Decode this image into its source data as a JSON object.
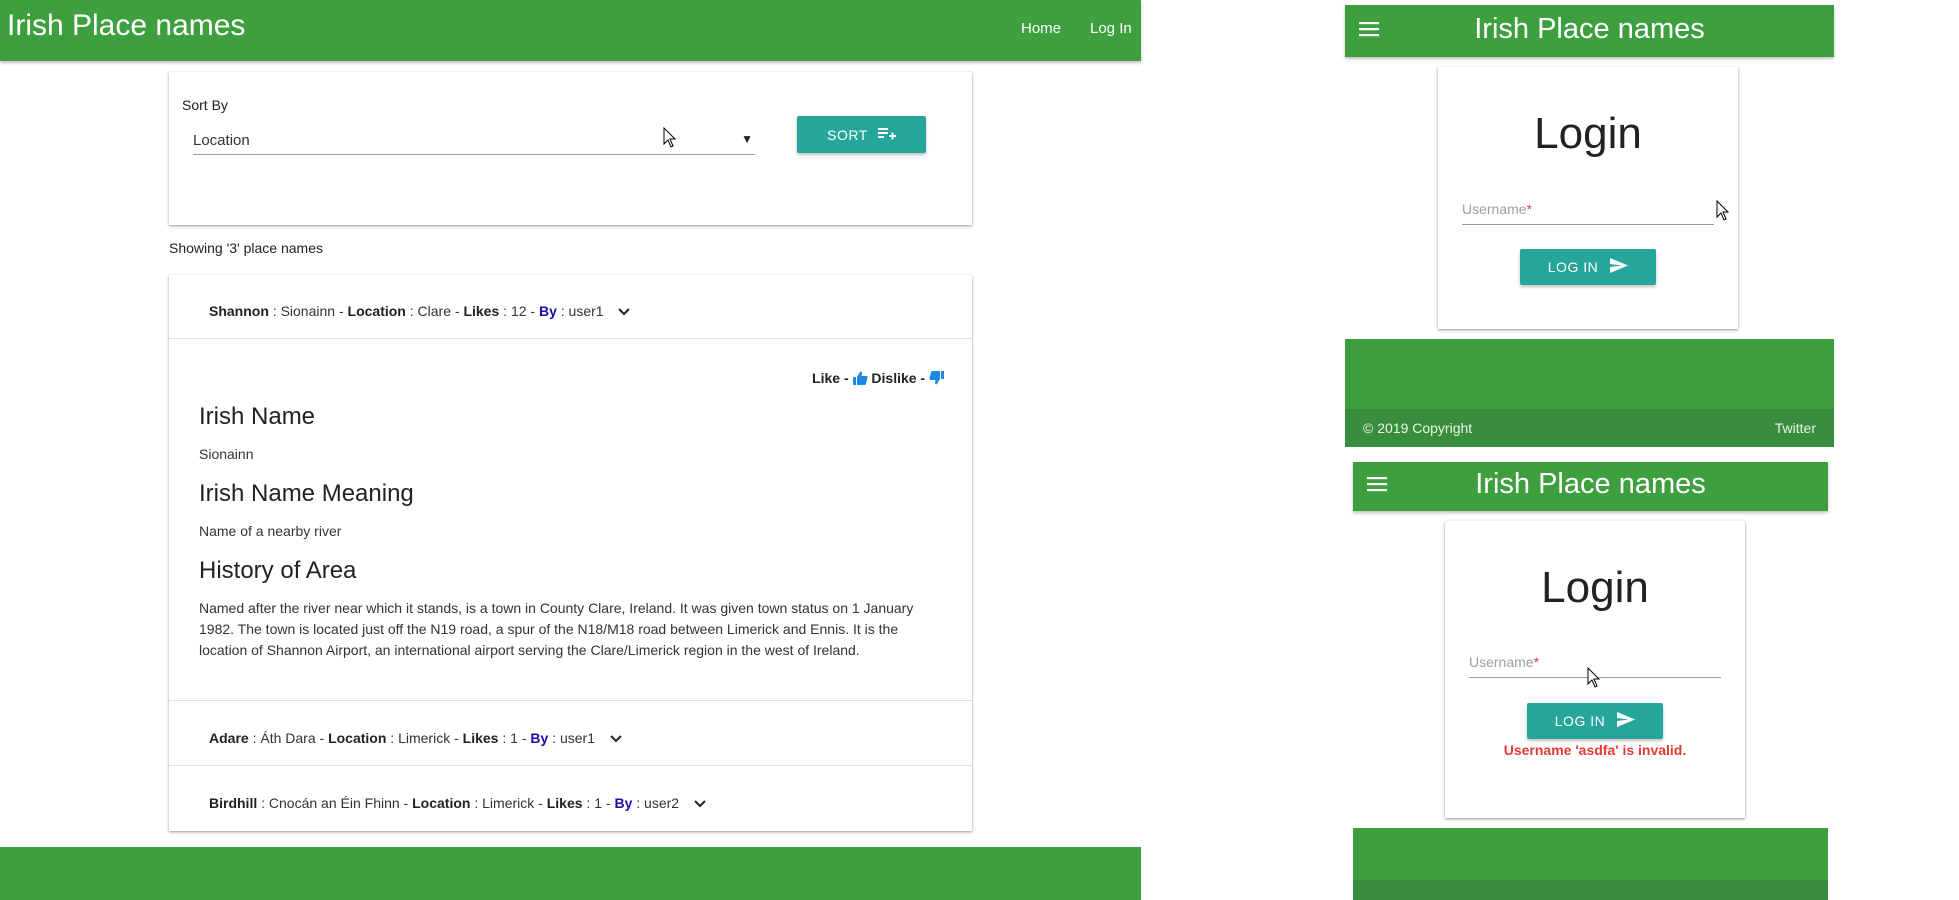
{
  "app_title": "Irish Place names",
  "nav": {
    "home": "Home",
    "login": "Log In"
  },
  "sort": {
    "label": "Sort By",
    "selected": "Location",
    "caret": "▼",
    "button": "SORT"
  },
  "showing_text": "Showing '3' place names",
  "places": [
    {
      "name": "Shannon",
      "irish": "Sionainn",
      "location": "Clare",
      "likes": "12",
      "by": "user1"
    },
    {
      "name": "Adare",
      "irish": "Áth Dara",
      "location": "Limerick",
      "likes": "1",
      "by": "user1"
    },
    {
      "name": "Birdhill",
      "irish": "Cnocán an Éin Fhinn",
      "location": "Limerick",
      "likes": "1",
      "by": "user2"
    }
  ],
  "labels": {
    "location": "Location",
    "likes": "Likes",
    "by": "By",
    "sep_colon": " : ",
    "sep_dash": " - "
  },
  "detail": {
    "like": "Like",
    "dislike": "Dislike",
    "irish_name_h": "Irish Name",
    "irish_name": "Sionainn",
    "meaning_h": "Irish Name Meaning",
    "meaning": "Name of a nearby river",
    "history_h": "History of Area",
    "history": "Named after the river near which it stands, is a town in County Clare, Ireland. It was given town status on 1 January 1982. The town is located just off the N19 road, a spur of the N18/M18 road between Limerick and Ennis. It is the location of Shannon Airport, an international airport serving the Clare/Limerick region in the west of Ireland."
  },
  "mobile": {
    "login_title": "Login",
    "username_placeholder": "Username",
    "required_mark": "*",
    "login_button": "LOG IN",
    "copyright": "© 2019 Copyright",
    "twitter": "Twitter",
    "error": "Username 'asdfa' is invalid."
  },
  "colors": {
    "brand_green": "#3d9f3e",
    "teal_button": "#26a69a",
    "like_blue": "#1e88e5",
    "error_red": "#e53935"
  },
  "icons": [
    "menu-icon",
    "chevron-down-icon",
    "thumbs-up-icon",
    "thumbs-down-icon",
    "send-icon",
    "playlist-add-icon",
    "mouse-cursor-icon"
  ]
}
